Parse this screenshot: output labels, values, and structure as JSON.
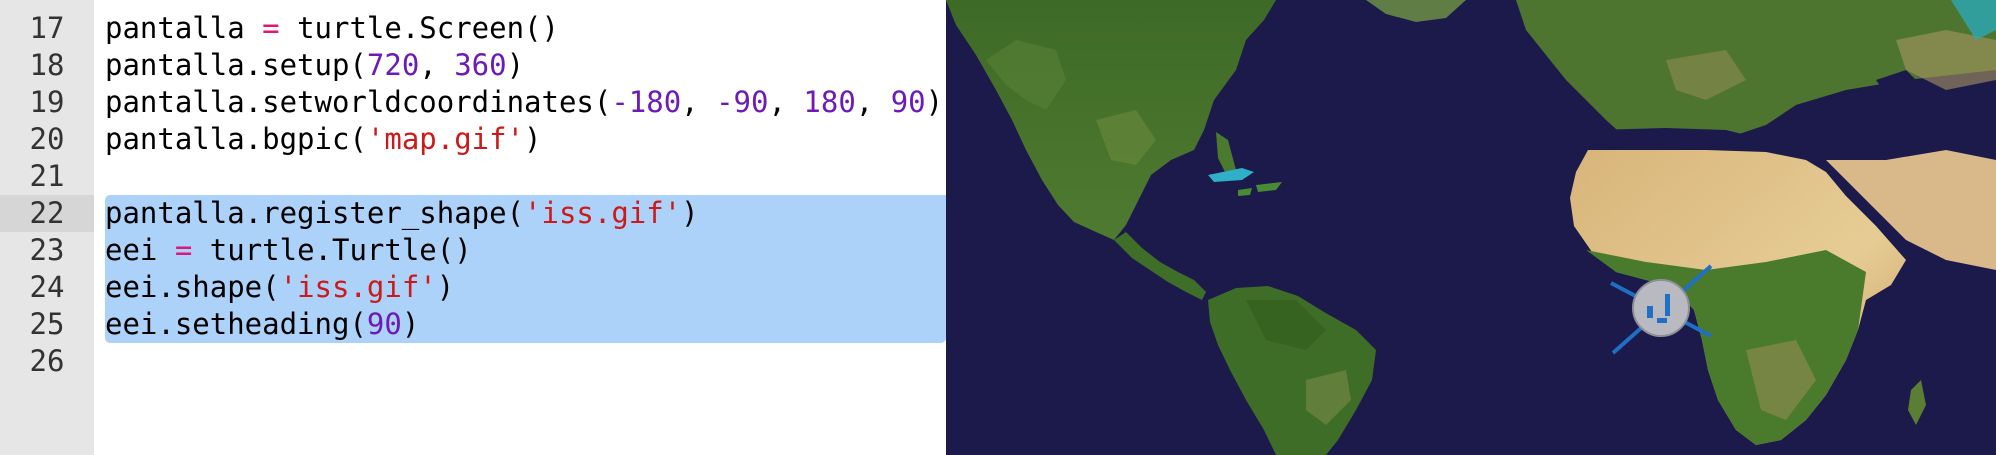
{
  "editor": {
    "current_line": "22",
    "lines": [
      {
        "number": "17",
        "tokens": [
          {
            "t": "txt",
            "v": "pantalla "
          },
          {
            "t": "op",
            "v": "="
          },
          {
            "t": "txt",
            "v": " turtle.Screen()"
          }
        ]
      },
      {
        "number": "18",
        "tokens": [
          {
            "t": "txt",
            "v": "pantalla.setup("
          },
          {
            "t": "num",
            "v": "720"
          },
          {
            "t": "txt",
            "v": ", "
          },
          {
            "t": "num",
            "v": "360"
          },
          {
            "t": "txt",
            "v": ")"
          }
        ]
      },
      {
        "number": "19",
        "tokens": [
          {
            "t": "txt",
            "v": "pantalla.setworldcoordinates("
          },
          {
            "t": "num",
            "v": "-180"
          },
          {
            "t": "txt",
            "v": ", "
          },
          {
            "t": "num",
            "v": "-90"
          },
          {
            "t": "txt",
            "v": ", "
          },
          {
            "t": "num",
            "v": "180"
          },
          {
            "t": "txt",
            "v": ", "
          },
          {
            "t": "num",
            "v": "90"
          },
          {
            "t": "txt",
            "v": ")"
          }
        ]
      },
      {
        "number": "20",
        "tokens": [
          {
            "t": "txt",
            "v": "pantalla.bgpic("
          },
          {
            "t": "str",
            "v": "'map.gif'"
          },
          {
            "t": "txt",
            "v": ")"
          }
        ]
      },
      {
        "number": "21",
        "tokens": []
      },
      {
        "number": "22",
        "selected": true,
        "tokens": [
          {
            "t": "txt",
            "v": "pantalla.register_shape("
          },
          {
            "t": "str",
            "v": "'iss.gif'"
          },
          {
            "t": "txt",
            "v": ")"
          }
        ]
      },
      {
        "number": "23",
        "selected": true,
        "tokens": [
          {
            "t": "txt",
            "v": "eei "
          },
          {
            "t": "op",
            "v": "="
          },
          {
            "t": "txt",
            "v": " turtle.Turtle()"
          }
        ]
      },
      {
        "number": "24",
        "selected": true,
        "tokens": [
          {
            "t": "txt",
            "v": "eei.shape("
          },
          {
            "t": "str",
            "v": "'iss.gif'"
          },
          {
            "t": "txt",
            "v": ")"
          }
        ]
      },
      {
        "number": "25",
        "selected": true,
        "tokens": [
          {
            "t": "txt",
            "v": "eei.setheading("
          },
          {
            "t": "num",
            "v": "90"
          },
          {
            "t": "txt",
            "v": ")"
          }
        ]
      },
      {
        "number": "26",
        "tokens": []
      }
    ]
  },
  "map": {
    "ocean_color": "#1b1a4a",
    "land_colors": [
      "#3f6b2a",
      "#5a7e34",
      "#c9a46a",
      "#e0c48a"
    ],
    "sprite_icon": "iss-satellite-icon"
  }
}
